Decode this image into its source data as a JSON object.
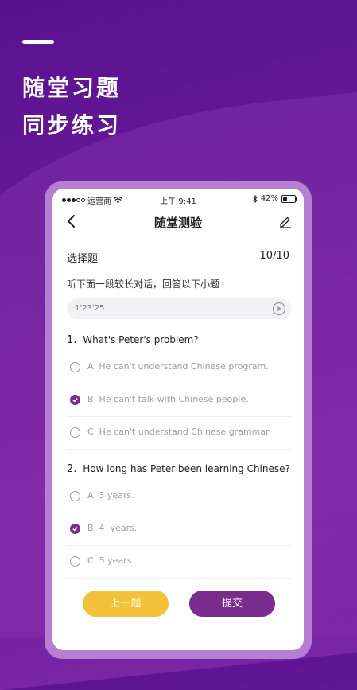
{
  "promo": {
    "line1": "随堂习题",
    "line2": "同步练习"
  },
  "status": {
    "carrier": "运营商",
    "time": "上午 9:41",
    "battery": "42%",
    "battery_level": 0.42
  },
  "nav": {
    "title": "随堂测验"
  },
  "section": {
    "title": "选择题",
    "count": "10/10"
  },
  "instruction": "听下面一段较长对话，回答以下小题",
  "audio": {
    "time": "1'23'25"
  },
  "questions": [
    {
      "number": "1.",
      "text": "What's Peter's problem?",
      "options": [
        {
          "label": "A. He can't understand Chinese program.",
          "checked": false
        },
        {
          "label": "B. He can't talk with Chinese people.",
          "checked": true
        },
        {
          "label": "C. He can't understand Chinese grammar.",
          "checked": false
        }
      ]
    },
    {
      "number": "2.",
      "text": "How long has Peter been learning Chinese?",
      "options": [
        {
          "label": "A. 3 years.",
          "checked": false
        },
        {
          "label": "B. 4  years.",
          "checked": true
        },
        {
          "label": "C. 5 years.",
          "checked": false
        }
      ]
    }
  ],
  "buttons": {
    "prev": "上一题",
    "submit": "提交"
  },
  "colors": {
    "accent": "#7b2d8e",
    "prev_button": "#f2c23a",
    "background": "#6a1b9a"
  }
}
